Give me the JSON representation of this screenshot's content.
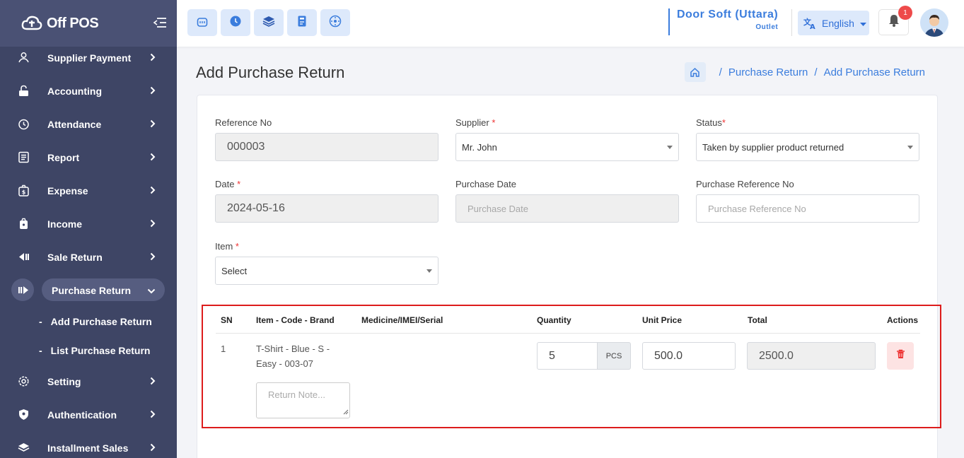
{
  "brand": {
    "name": "Off POS"
  },
  "sidebar": {
    "items": [
      {
        "label": "Supplier Payment",
        "icon": "supplier-payment-icon"
      },
      {
        "label": "Accounting",
        "icon": "lock-icon"
      },
      {
        "label": "Attendance",
        "icon": "alarm-clock-icon"
      },
      {
        "label": "Report",
        "icon": "report-icon"
      },
      {
        "label": "Expense",
        "icon": "expense-icon"
      },
      {
        "label": "Income",
        "icon": "income-icon"
      },
      {
        "label": "Sale Return",
        "icon": "sale-return-icon"
      },
      {
        "label": "Purchase Return",
        "icon": "purchase-return-icon",
        "active": true
      },
      {
        "label": "Setting",
        "icon": "gear-icon"
      },
      {
        "label": "Authentication",
        "icon": "shield-icon"
      },
      {
        "label": "Installment Sales",
        "icon": "layers-icon"
      }
    ],
    "sub_items": [
      {
        "label": "Add Purchase Return"
      },
      {
        "label": "List Purchase Return"
      }
    ]
  },
  "topbar": {
    "quick_icons": [
      "store-icon",
      "clock-icon",
      "layers-icon",
      "calculator-icon",
      "dashboard-icon"
    ],
    "outlet_name": "Door Soft (Uttara)",
    "outlet_label": "Outlet",
    "language": "English",
    "notification_count": "1"
  },
  "page": {
    "title": "Add Purchase Return",
    "breadcrumb": [
      "Purchase Return",
      "Add Purchase Return"
    ]
  },
  "form": {
    "reference_no": {
      "label": "Reference No",
      "value": "000003"
    },
    "supplier": {
      "label": "Supplier",
      "value": "Mr. John"
    },
    "status": {
      "label": "Status",
      "value": "Taken by supplier product returned"
    },
    "date": {
      "label": "Date",
      "value": "2024-05-16"
    },
    "purchase_date": {
      "label": "Purchase Date",
      "placeholder": "Purchase Date"
    },
    "purchase_reference_no": {
      "label": "Purchase Reference No",
      "placeholder": "Purchase Reference No"
    },
    "item": {
      "label": "Item",
      "value": "Select"
    },
    "required_mark": "*"
  },
  "table": {
    "headers": {
      "sn": "SN",
      "item": "Item - Code - Brand",
      "serial": "Medicine/IMEI/Serial",
      "quantity": "Quantity",
      "unit_price": "Unit Price",
      "total": "Total",
      "actions": "Actions"
    },
    "rows": [
      {
        "sn": "1",
        "item_line1": "T-Shirt - Blue - S -",
        "item_line2": "Easy - 003-07",
        "quantity": "5",
        "unit": "PCS",
        "unit_price": "500.0",
        "total": "2500.0",
        "note_placeholder": "Return Note..."
      }
    ]
  },
  "colors": {
    "sidebar": "#3e4565",
    "accent": "#3b7ddd",
    "danger": "#dd1c1c"
  }
}
